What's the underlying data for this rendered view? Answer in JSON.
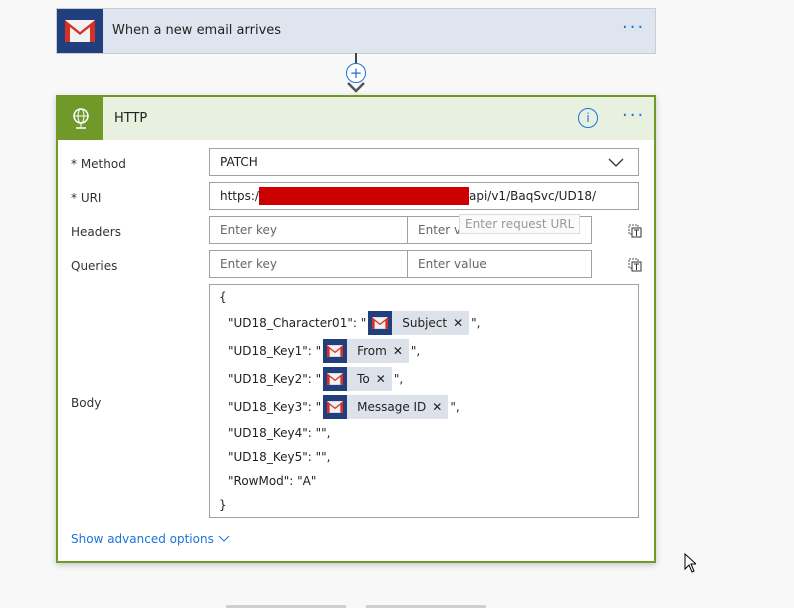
{
  "trigger": {
    "title": "When a new email arrives",
    "more": "···"
  },
  "connector": {
    "add": "+"
  },
  "action": {
    "title": "HTTP",
    "info": "i",
    "more": "···",
    "fields": {
      "method": {
        "label": "* Method",
        "value": "PATCH"
      },
      "uri": {
        "label": "* URI",
        "prefix": "https:/",
        "suffix": "api/v1/BaqSvc/UD18/",
        "tooltip": "Enter request URL"
      },
      "headers": {
        "label": "Headers",
        "key_placeholder": "Enter key",
        "value_placeholder": "Enter value"
      },
      "queries": {
        "label": "Queries",
        "key_placeholder": "Enter key",
        "value_placeholder": "Enter value"
      },
      "body": {
        "label": "Body",
        "open": "{",
        "close": "}",
        "lines": [
          {
            "key": "\"UD18_Character01\": \"",
            "token": "Subject",
            "end": "\","
          },
          {
            "key": "\"UD18_Key1\": \"",
            "token": "From",
            "end": "\","
          },
          {
            "key": "\"UD18_Key2\": \"",
            "token": "To",
            "end": "\","
          },
          {
            "key": "\"UD18_Key3\": \"",
            "token": "Message ID",
            "end": "\","
          },
          {
            "key": "\"UD18_Key4\": \"\","
          },
          {
            "key": "\"UD18_Key5\": \"\","
          },
          {
            "key": "\"RowMod\": \"A\""
          }
        ]
      }
    },
    "advanced": "Show advanced options"
  },
  "colors": {
    "accent": "#1a73d9",
    "http_green": "#6f9a2a",
    "gmail_blue": "#213f7d",
    "redact": "#cc0000"
  }
}
